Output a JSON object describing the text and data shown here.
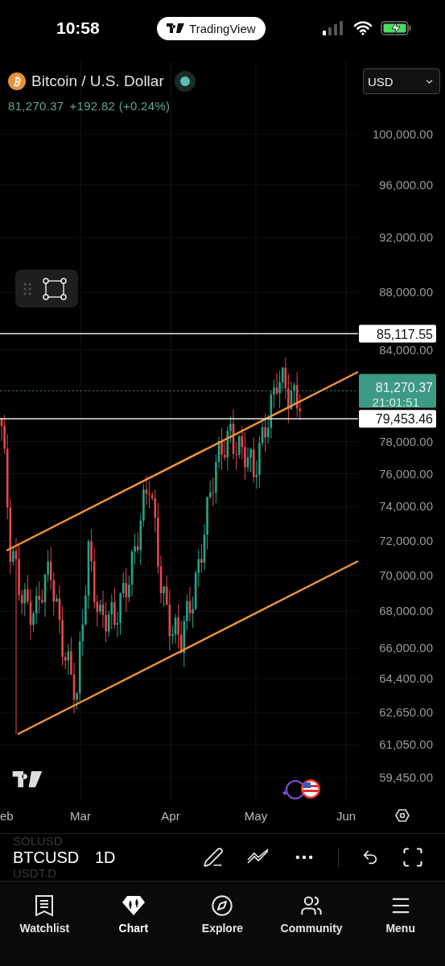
{
  "status_bar": {
    "time": "10:58",
    "app_pill": "TradingView",
    "battery_charging": true
  },
  "header": {
    "title": "Bitcoin / U.S. Dollar",
    "market_status": {
      "color": "#5bbfae"
    },
    "price": "81,270.37",
    "change": "+192.82 (+0.24%)",
    "currency": "USD"
  },
  "price_axis": {
    "ticks": [
      "100,000.00",
      "96,000.00",
      "92,000.00",
      "88,000.00",
      "84,000.00",
      "78,000.00",
      "76,000.00",
      "74,000.00",
      "72,000.00",
      "70,000.00",
      "68,000.00",
      "66,000.00",
      "64,400.00",
      "62,650.00",
      "61,050.00",
      "59,450.00"
    ]
  },
  "price_lines": [
    {
      "kind": "horizontal",
      "price": "85,117.55"
    },
    {
      "kind": "last",
      "price": "81,270.37",
      "countdown": "21:01:51"
    },
    {
      "kind": "horizontal",
      "price": "79,453.46"
    }
  ],
  "time_axis": {
    "labels": [
      "eb",
      "Mar",
      "Apr",
      "May",
      "Jun"
    ]
  },
  "toolbar": {
    "symbols": [
      {
        "label": "SOLUSD",
        "selected": false
      },
      {
        "label": "BTCUSD",
        "selected": true
      },
      {
        "label": "USDT.D",
        "selected": false
      }
    ],
    "interval": "1D"
  },
  "tabs": [
    {
      "label": "Watchlist",
      "selected": false
    },
    {
      "label": "Chart",
      "selected": true
    },
    {
      "label": "Explore",
      "selected": false
    },
    {
      "label": "Community",
      "selected": false
    },
    {
      "label": "Menu",
      "selected": false
    }
  ]
}
